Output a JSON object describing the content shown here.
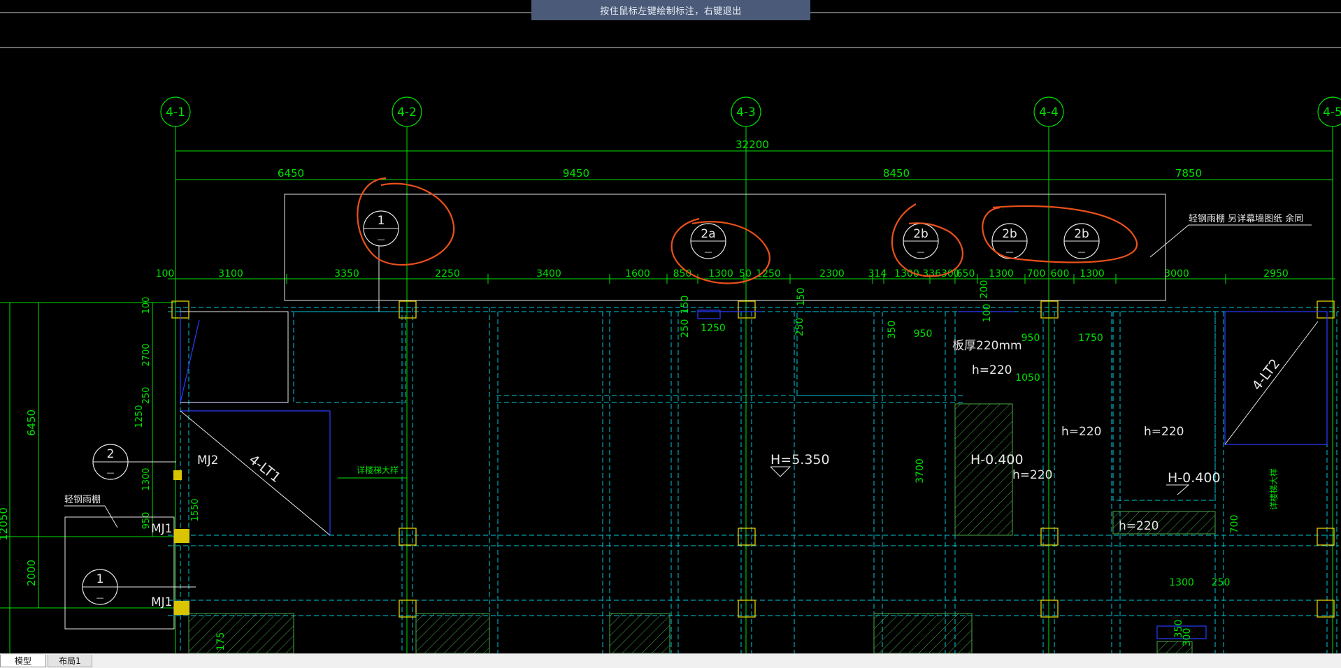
{
  "banner": {
    "message": "按住鼠标左键绘制标注，右键退出"
  },
  "tabs": [
    {
      "label": "模型"
    },
    {
      "label": "布局1"
    }
  ],
  "grid_axes": [
    "4-1",
    "4-2",
    "4-3",
    "4-4",
    "4-5"
  ],
  "dims": {
    "total": "32200",
    "spans": [
      "6450",
      "9450",
      "8450",
      "7850"
    ],
    "sub": [
      "100",
      "3100",
      "3350",
      "2250",
      "3400",
      "1600",
      "850",
      "1300",
      "50",
      "1250",
      "2300",
      "314",
      "1300",
      "336300",
      "650",
      "1300",
      "700",
      "600",
      "1300",
      "3000",
      "2950"
    ],
    "left_vertical": [
      "6450",
      "12050",
      "2000"
    ],
    "left_small": [
      "100",
      "2700",
      "250",
      "1250",
      "1300",
      "950",
      "1550"
    ],
    "inner": [
      "1250",
      "950",
      "950",
      "1750",
      "1050",
      "3700",
      "1300",
      "250",
      "700",
      "150",
      "250",
      "350",
      "150",
      "200",
      "100",
      "250",
      "300",
      "350",
      "175"
    ]
  },
  "annotations": {
    "note_top_right": "轻钢雨棚 另详幕墙图纸 余同",
    "note_left": "轻钢雨棚",
    "slab_thickness": "板厚220mm",
    "h220": "h=220",
    "elev_5350": "H=5.350",
    "elev_m0400": "H-0.400",
    "stair_detail": "详楼梯大样",
    "door_mj2": "MJ2",
    "door_mj1": "MJ1",
    "stair_4lt1": "4-LT1",
    "stair_4lt2": "4-LT2"
  },
  "callouts": {
    "c1_top": "1",
    "c2a": "2a",
    "c2b": "2b",
    "c2_left": "2",
    "c1_left": "1",
    "dash": "—"
  }
}
